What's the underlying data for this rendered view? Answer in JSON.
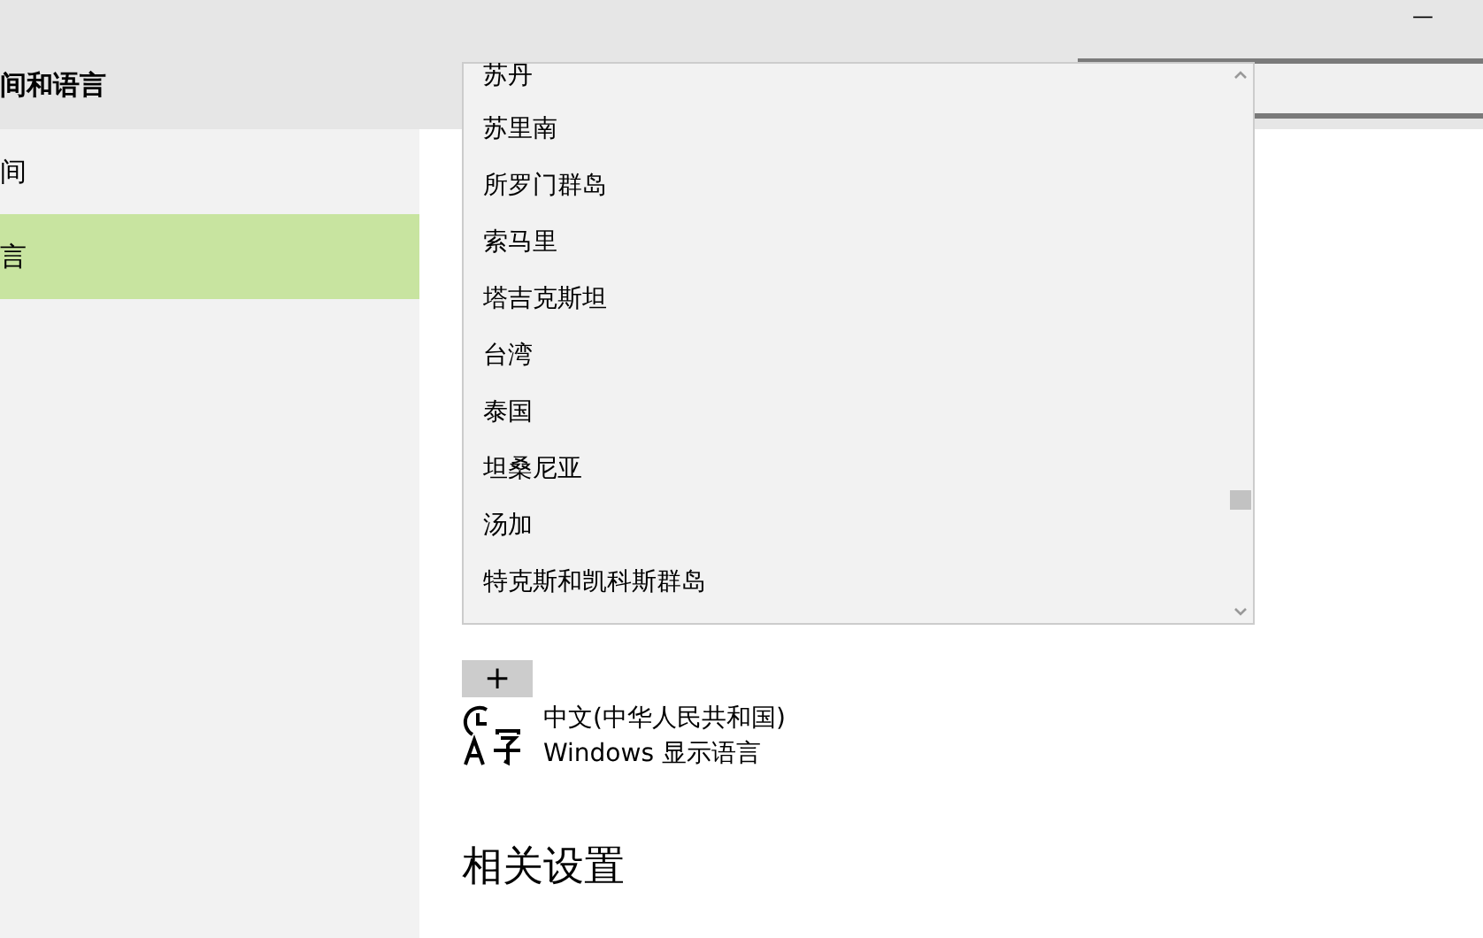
{
  "window": {
    "title": "间和语言",
    "minimize": "—"
  },
  "sidebar": {
    "items": [
      {
        "label": "间",
        "selected": false
      },
      {
        "label": "言",
        "selected": true
      }
    ]
  },
  "dropdown": {
    "items": [
      "苏丹",
      "苏里南",
      "所罗门群岛",
      "索马里",
      "塔吉克斯坦",
      "台湾",
      "泰国",
      "坦桑尼亚",
      "汤加",
      "特克斯和凯科斯群岛"
    ]
  },
  "add_button": {
    "label": "+"
  },
  "language": {
    "name": "中文(中华人民共和国)",
    "detail": "Windows 显示语言"
  },
  "related": {
    "heading": "相关设置"
  }
}
